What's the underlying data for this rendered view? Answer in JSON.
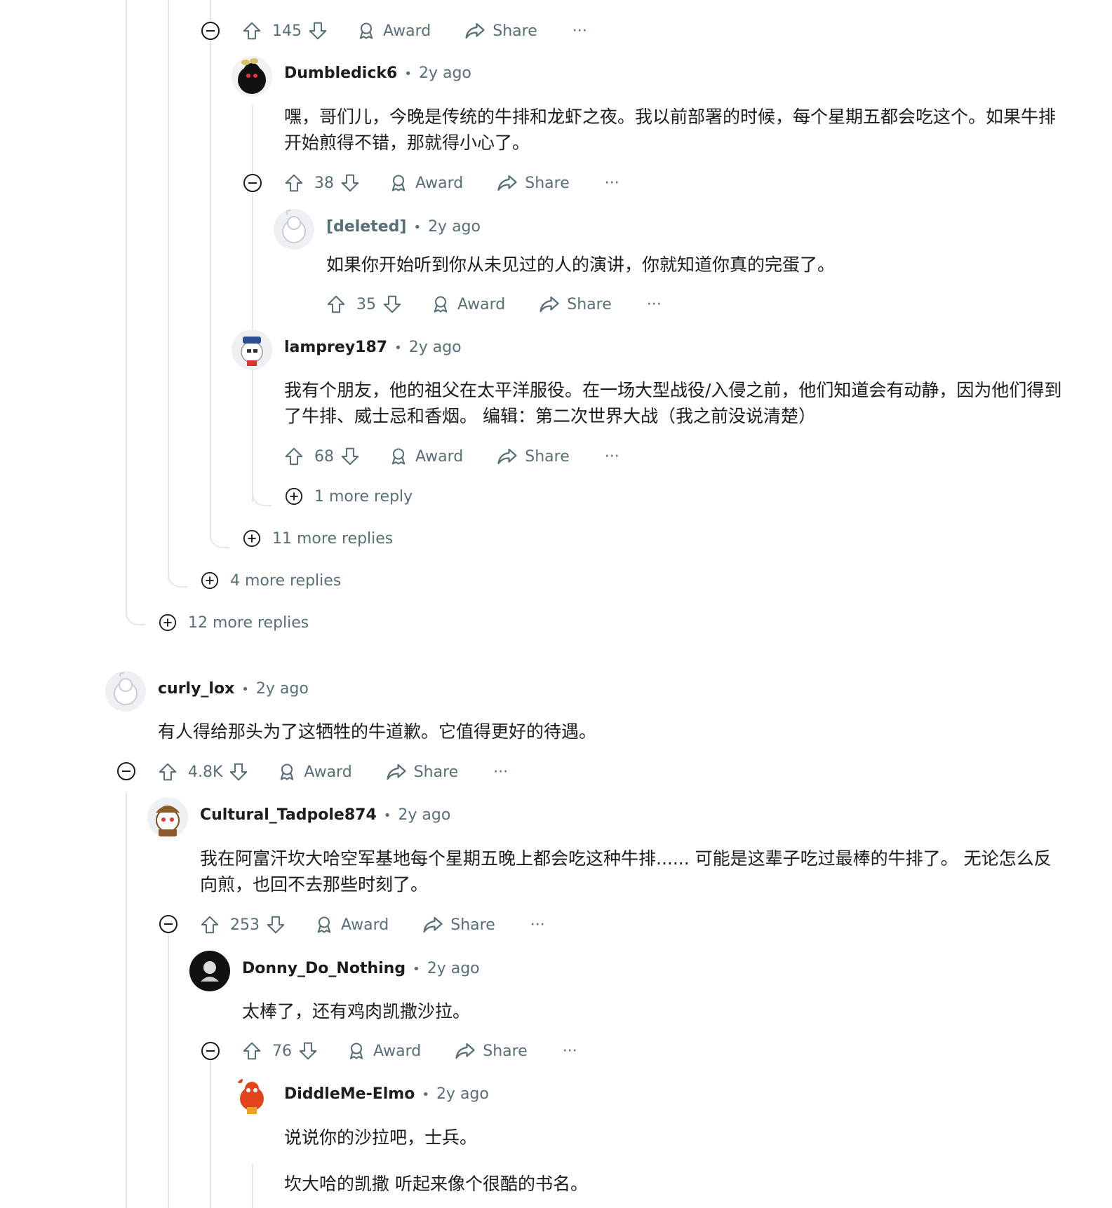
{
  "colors": {
    "text": "#1c1c1c",
    "meta": "#576f76",
    "thread": "#e5e7ea",
    "background": "#ffffff"
  },
  "labels": {
    "award": "Award",
    "share": "Share",
    "overflow": "···"
  },
  "comments": {
    "c0": {
      "votes": "145"
    },
    "c1": {
      "author": "Dumbledick6",
      "time": "2y ago",
      "body": "嘿，哥们儿，今晚是传统的牛排和龙虾之夜。我以前部署的时候，每个星期五都会吃这个。如果牛排开始煎得不错，那就得小心了。",
      "votes": "38"
    },
    "c2": {
      "author": "[deleted]",
      "time": "2y ago",
      "body": "如果你开始听到你从未见过的人的演讲，你就知道你真的完蛋了。",
      "votes": "35"
    },
    "c3": {
      "author": "lamprey187",
      "time": "2y ago",
      "body": "我有个朋友，他的祖父在太平洋服役。在一场大型战役/入侵之前，他们知道会有动静，因为他们得到了牛排、威士忌和香烟。 编辑：第二次世界大战（我之前没说清楚）",
      "votes": "68"
    },
    "c4": {
      "author": "curly_lox",
      "time": "2y ago",
      "body": "有人得给那头为了这牺牲的牛道歉。它值得更好的待遇。",
      "votes": "4.8K"
    },
    "c5": {
      "author": "Cultural_Tadpole874",
      "time": "2y ago",
      "body": "我在阿富汗坎大哈空军基地每个星期五晚上都会吃这种牛排...... 可能是这辈子吃过最棒的牛排了。 无论怎么反向煎，也回不去那些时刻了。",
      "votes": "253"
    },
    "c6": {
      "author": "Donny_Do_Nothing",
      "time": "2y ago",
      "body": "太棒了，还有鸡肉凯撒沙拉。",
      "votes": "76"
    },
    "c7": {
      "author": "DiddleMe-Elmo",
      "time": "2y ago",
      "body_line1": "说说你的沙拉吧，士兵。",
      "body_line2": "坎大哈的凯撒 听起来像个很酷的书名。"
    }
  },
  "more_replies": {
    "r1": "1 more reply",
    "r2": "11 more replies",
    "r3": "4 more replies",
    "r4": "12 more replies"
  },
  "icons": [
    "collapse-icon",
    "expand-icon",
    "upvote-icon",
    "downvote-icon",
    "award-icon",
    "share-icon",
    "overflow-icon"
  ]
}
